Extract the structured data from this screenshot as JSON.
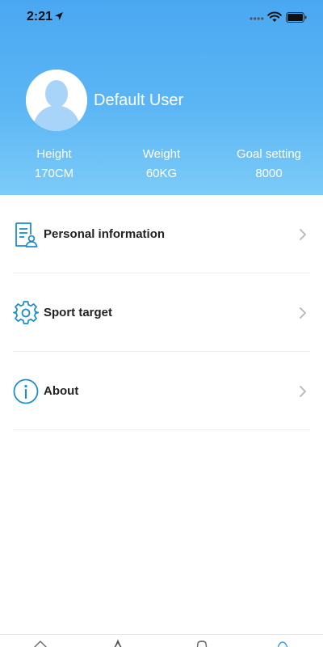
{
  "status_bar": {
    "time": "2:21"
  },
  "profile": {
    "name": "Default User",
    "stats": [
      {
        "label": "Height",
        "value": "170CM"
      },
      {
        "label": "Weight",
        "value": "60KG"
      },
      {
        "label": "Goal setting",
        "value": "8000"
      }
    ]
  },
  "menu": {
    "items": [
      {
        "label": "Personal information",
        "icon": "personal-info-icon"
      },
      {
        "label": "Sport target",
        "icon": "gear-icon"
      },
      {
        "label": "About",
        "icon": "info-icon"
      }
    ]
  },
  "tab_bar": {
    "tabs": [
      {
        "icon": "home-icon"
      },
      {
        "icon": "sport-icon"
      },
      {
        "icon": "device-icon"
      },
      {
        "icon": "profile-icon",
        "active": true
      }
    ]
  },
  "colors": {
    "header_top": "#4aa8f2",
    "header_bottom": "#7ccbf8",
    "accent": "#1a8fd0",
    "active_tab": "#2f9be8"
  }
}
